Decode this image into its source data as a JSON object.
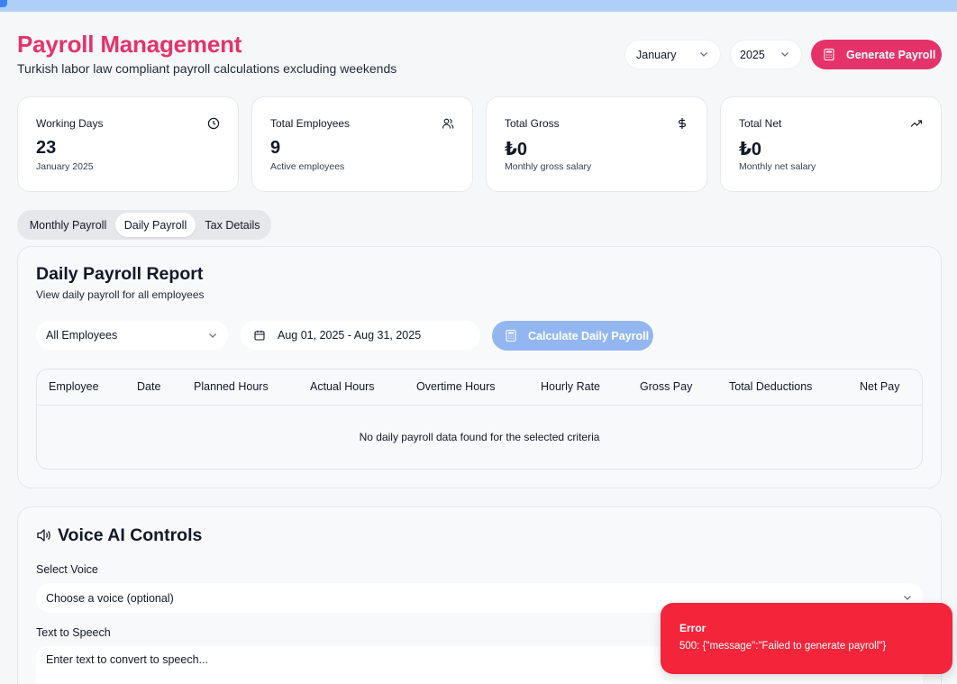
{
  "header": {
    "title": "Payroll Management",
    "subtitle": "Turkish labor law compliant payroll calculations excluding weekends",
    "month": "January",
    "year": "2025",
    "generate_label": "Generate Payroll"
  },
  "stats": [
    {
      "label": "Working Days",
      "value": "23",
      "sub": "January 2025",
      "icon": "clock-icon"
    },
    {
      "label": "Total Employees",
      "value": "9",
      "sub": "Active employees",
      "icon": "users-icon"
    },
    {
      "label": "Total Gross",
      "value": "₺0",
      "sub": "Monthly gross salary",
      "icon": "dollar-icon"
    },
    {
      "label": "Total Net",
      "value": "₺0",
      "sub": "Monthly net salary",
      "icon": "trending-up-icon"
    }
  ],
  "tabs": [
    {
      "label": "Monthly Payroll",
      "active": false
    },
    {
      "label": "Daily Payroll",
      "active": true
    },
    {
      "label": "Tax Details",
      "active": false
    }
  ],
  "daily": {
    "title": "Daily Payroll Report",
    "description": "View daily payroll for all employees",
    "employee_filter": "All Employees",
    "date_range": "Aug 01, 2025 - Aug 31, 2025",
    "calculate_label": "Calculate Daily Payroll",
    "columns": [
      "Employee",
      "Date",
      "Planned Hours",
      "Actual Hours",
      "Overtime Hours",
      "Hourly Rate",
      "Gross Pay",
      "Total Deductions",
      "Net Pay"
    ],
    "empty_text": "No daily payroll data found for the selected criteria"
  },
  "voice": {
    "title": "Voice AI Controls",
    "select_label": "Select Voice",
    "select_placeholder": "Choose a voice (optional)",
    "tts_label": "Text to Speech",
    "tts_placeholder": "Enter text to convert to speech..."
  },
  "toast": {
    "title": "Error",
    "message": "500: {\"message\":\"Failed to generate payroll\"}"
  },
  "colors": {
    "brand": "#e5336a",
    "disabled_button": "#93b6f1",
    "error": "#f4243a"
  }
}
